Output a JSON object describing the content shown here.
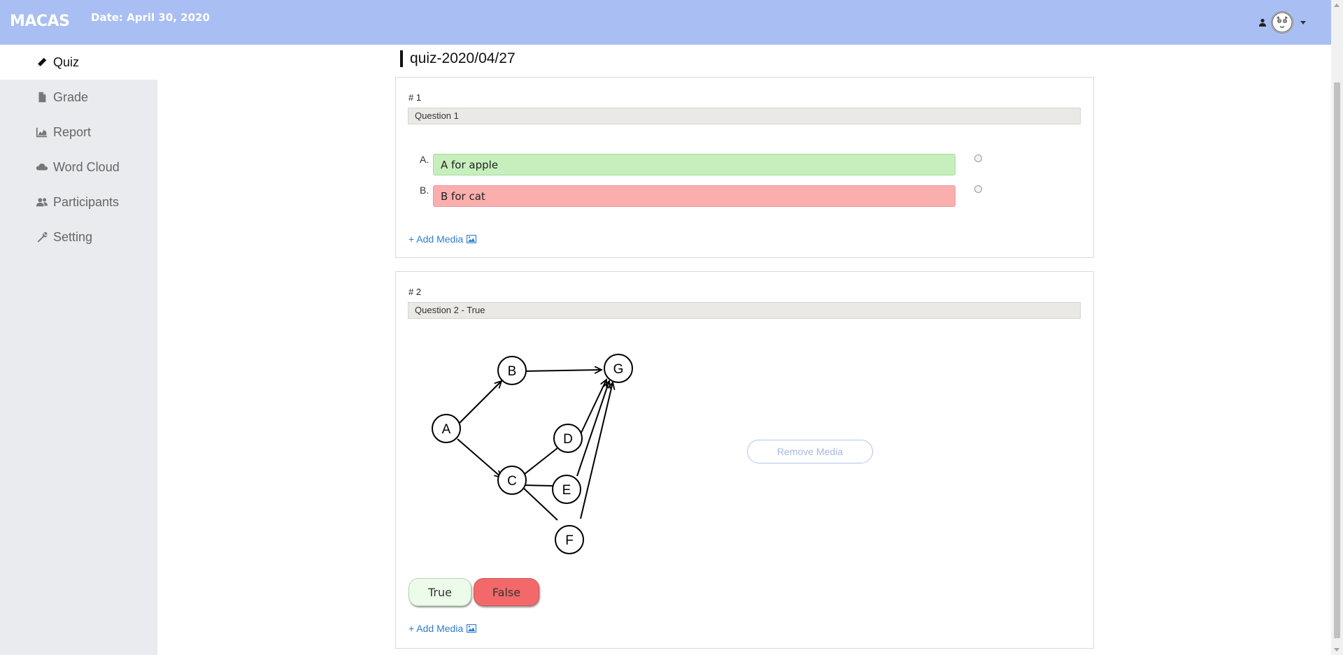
{
  "header": {
    "brand": "MACAS",
    "date": "Date: April 30, 2020",
    "user_icon": "user-icon",
    "avatar_icon": "avatar-face-icon",
    "menu_caret": "chevron-down-icon",
    "bar_color": "#a9bef2"
  },
  "sidebar": {
    "items": [
      {
        "label": "Quiz",
        "icon": "pencil-icon",
        "active": true
      },
      {
        "label": "Grade",
        "icon": "file-icon",
        "active": false
      },
      {
        "label": "Report",
        "icon": "area-chart-icon",
        "active": false
      },
      {
        "label": "Word Cloud",
        "icon": "cloud-icon",
        "active": false
      },
      {
        "label": "Participants",
        "icon": "users-icon",
        "active": false
      },
      {
        "label": "Setting",
        "icon": "wrench-icon",
        "active": false
      }
    ]
  },
  "main": {
    "quiz_title": "quiz-2020/04/27",
    "questions": [
      {
        "number": "# 1",
        "text": "Question 1",
        "options": [
          {
            "letter": "A.",
            "text": "A for apple",
            "state": "correct",
            "color": "#c6efbd"
          },
          {
            "letter": "B.",
            "text": "B for cat",
            "state": "wrong",
            "color": "#fbaeae"
          }
        ],
        "add_media_label": "+ Add Media",
        "add_media_icon": "image-icon"
      },
      {
        "number": "# 2",
        "text": "Question 2 - True",
        "media": {
          "type": "directed-graph",
          "nodes": [
            "A",
            "B",
            "C",
            "D",
            "E",
            "F",
            "G"
          ],
          "edges": [
            [
              "A",
              "B"
            ],
            [
              "A",
              "C"
            ],
            [
              "B",
              "G"
            ],
            [
              "C",
              "D"
            ],
            [
              "C",
              "E"
            ],
            [
              "C",
              "F"
            ],
            [
              "D",
              "G"
            ],
            [
              "E",
              "G"
            ],
            [
              "F",
              "G"
            ]
          ]
        },
        "remove_media_label": "Remove Media",
        "true_label": "True",
        "false_label": "False",
        "true_color": "#edfbea",
        "false_color": "#f36969",
        "add_media_label": "+ Add Media",
        "add_media_icon": "image-icon"
      }
    ]
  }
}
